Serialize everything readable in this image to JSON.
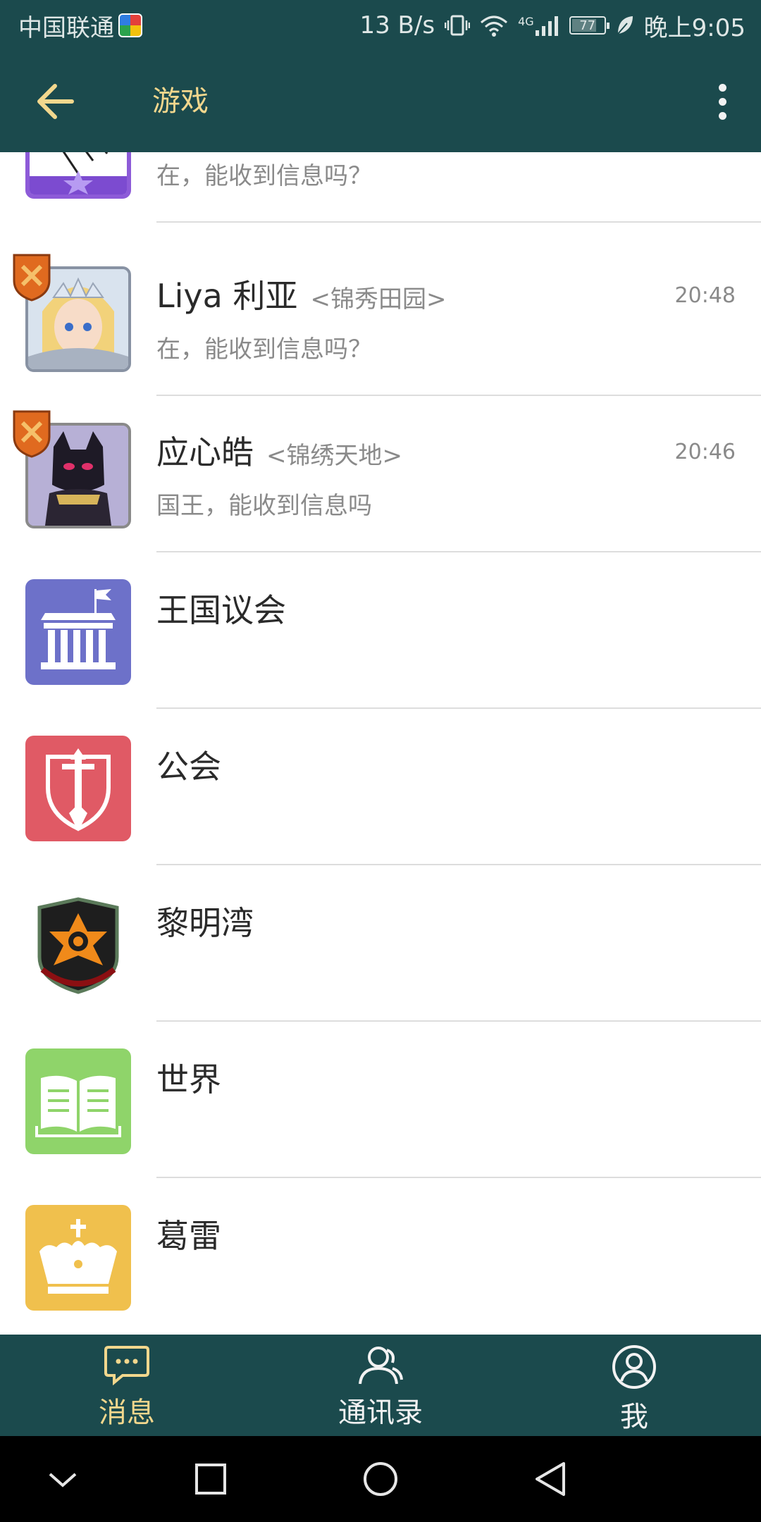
{
  "status_bar": {
    "carrier": "中国联通",
    "speed": "13 B/s",
    "network": "4G",
    "battery": "77",
    "battery_level": 0.77,
    "time": "晚上9:05"
  },
  "header": {
    "title": "游戏"
  },
  "conversations": [
    {
      "name": "",
      "tag": "",
      "time": "",
      "preview": "在，能收到信息吗？",
      "avatar": "purple-hero-avatar",
      "badge": false
    },
    {
      "name": "Liya 利亚",
      "tag": "<锦秀田园>",
      "time": "20:48",
      "preview": "在，能收到信息吗？",
      "avatar": "blonde-queen-avatar",
      "badge": true
    },
    {
      "name": "应心皓",
      "tag": "<锦绣天地>",
      "time": "20:46",
      "preview": "国王，能收到信息吗",
      "avatar": "black-cat-avatar",
      "badge": true
    }
  ],
  "channels": [
    {
      "name": "王国议会",
      "icon": "parliament-icon",
      "color": "#6d71c9"
    },
    {
      "name": "公会",
      "icon": "guild-sword-icon",
      "color": "#e05a65"
    },
    {
      "name": "黎明湾",
      "icon": "dawn-bay-emblem-icon",
      "color": "#1e1e1e"
    },
    {
      "name": "世界",
      "icon": "open-book-icon",
      "color": "#8fd46a"
    },
    {
      "name": "葛雷",
      "icon": "crown-icon",
      "color": "#f0c04d"
    }
  ],
  "bottom_nav": [
    {
      "label": "消息",
      "icon": "message-icon",
      "active": true
    },
    {
      "label": "通讯录",
      "icon": "contacts-icon",
      "active": false
    },
    {
      "label": "我",
      "icon": "profile-icon",
      "active": false
    }
  ],
  "colors": {
    "primary": "#1b4a4d",
    "accent": "#f2d78d",
    "text": "#2a2a2a",
    "muted": "#8a8a8a"
  }
}
